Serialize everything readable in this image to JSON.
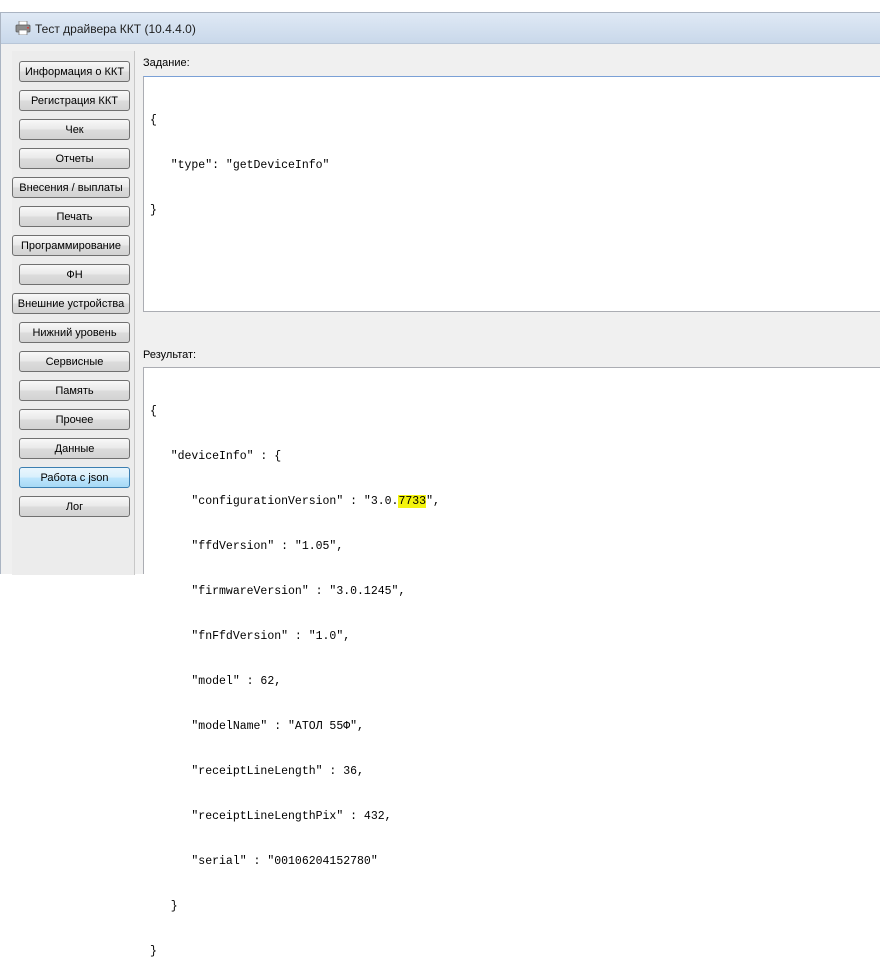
{
  "window": {
    "title": "Тест драйвера ККТ (10.4.4.0)",
    "icon": "printer-icon"
  },
  "sidebar": {
    "items": [
      {
        "label": "Информация о ККТ",
        "active": false
      },
      {
        "label": "Регистрация ККТ",
        "active": false
      },
      {
        "label": "Чек",
        "active": false
      },
      {
        "label": "Отчеты",
        "active": false
      },
      {
        "label": "Внесения / выплаты",
        "active": false
      },
      {
        "label": "Печать",
        "active": false
      },
      {
        "label": "Программирование",
        "active": false
      },
      {
        "label": "ФН",
        "active": false
      },
      {
        "label": "Внешние устройства",
        "active": false
      },
      {
        "label": "Нижний уровень",
        "active": false
      },
      {
        "label": "Сервисные",
        "active": false
      },
      {
        "label": "Память",
        "active": false
      },
      {
        "label": "Прочее",
        "active": false
      },
      {
        "label": "Данные",
        "active": false
      },
      {
        "label": "Работа с json",
        "active": true
      },
      {
        "label": "Лог",
        "active": false
      }
    ]
  },
  "task": {
    "label": "Задание:",
    "lines": [
      "{",
      "   \"type\": \"getDeviceInfo\"",
      "}"
    ]
  },
  "result": {
    "label": "Результат:",
    "lines": [
      "{",
      "   \"deviceInfo\" : {",
      "      \"configurationVersion\" : \"3.0.",
      "      \"ffdVersion\" : \"1.05\",",
      "      \"firmwareVersion\" : \"3.0.1245\",",
      "      \"fnFfdVersion\" : \"1.0\",",
      "      \"model\" : 62,",
      "      \"modelName\" : \"АТОЛ 55Ф\",",
      "      \"receiptLineLength\" : 36,",
      "      \"receiptLineLengthPix\" : 432,",
      "      \"serial\" : \"00106204152780\"",
      "   }",
      "}"
    ],
    "highlight": "7733",
    "highlight_suffix": "\","
  },
  "colors": {
    "highlight": "#f3f30e",
    "active_button": "#bee6fd"
  }
}
